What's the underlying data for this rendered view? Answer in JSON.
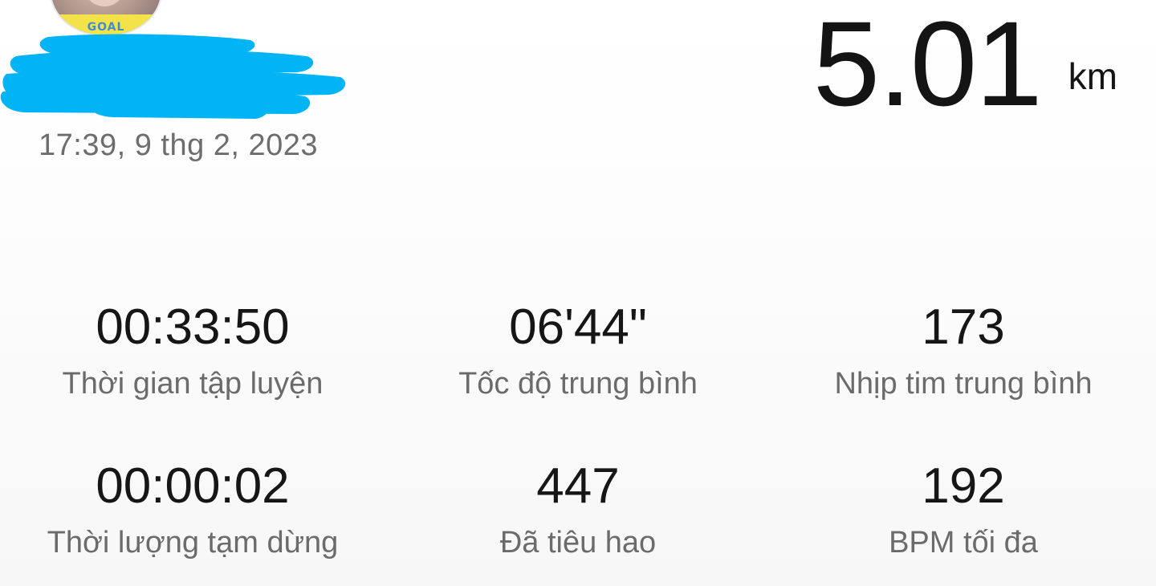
{
  "profile": {
    "avatar_badge": "GOAL",
    "date": "17:39, 9 thg 2, 2023"
  },
  "activity": {
    "distance_value": "5.01",
    "distance_unit": "km"
  },
  "stats": [
    {
      "value": "00:33:50",
      "label": "Thời gian tập luyện"
    },
    {
      "value": "06'44\"",
      "label": "Tốc độ trung bình"
    },
    {
      "value": "173",
      "label": "Nhịp tim trung bình"
    },
    {
      "value": "00:00:02",
      "label": "Thời lượng tạm dừng"
    },
    {
      "value": "447",
      "label": "Đã tiêu hao"
    },
    {
      "value": "192",
      "label": "BPM tối đa"
    }
  ],
  "colors": {
    "redaction": "#00b4f5",
    "primary_text": "#161616",
    "secondary_text": "#6b6b6b"
  }
}
